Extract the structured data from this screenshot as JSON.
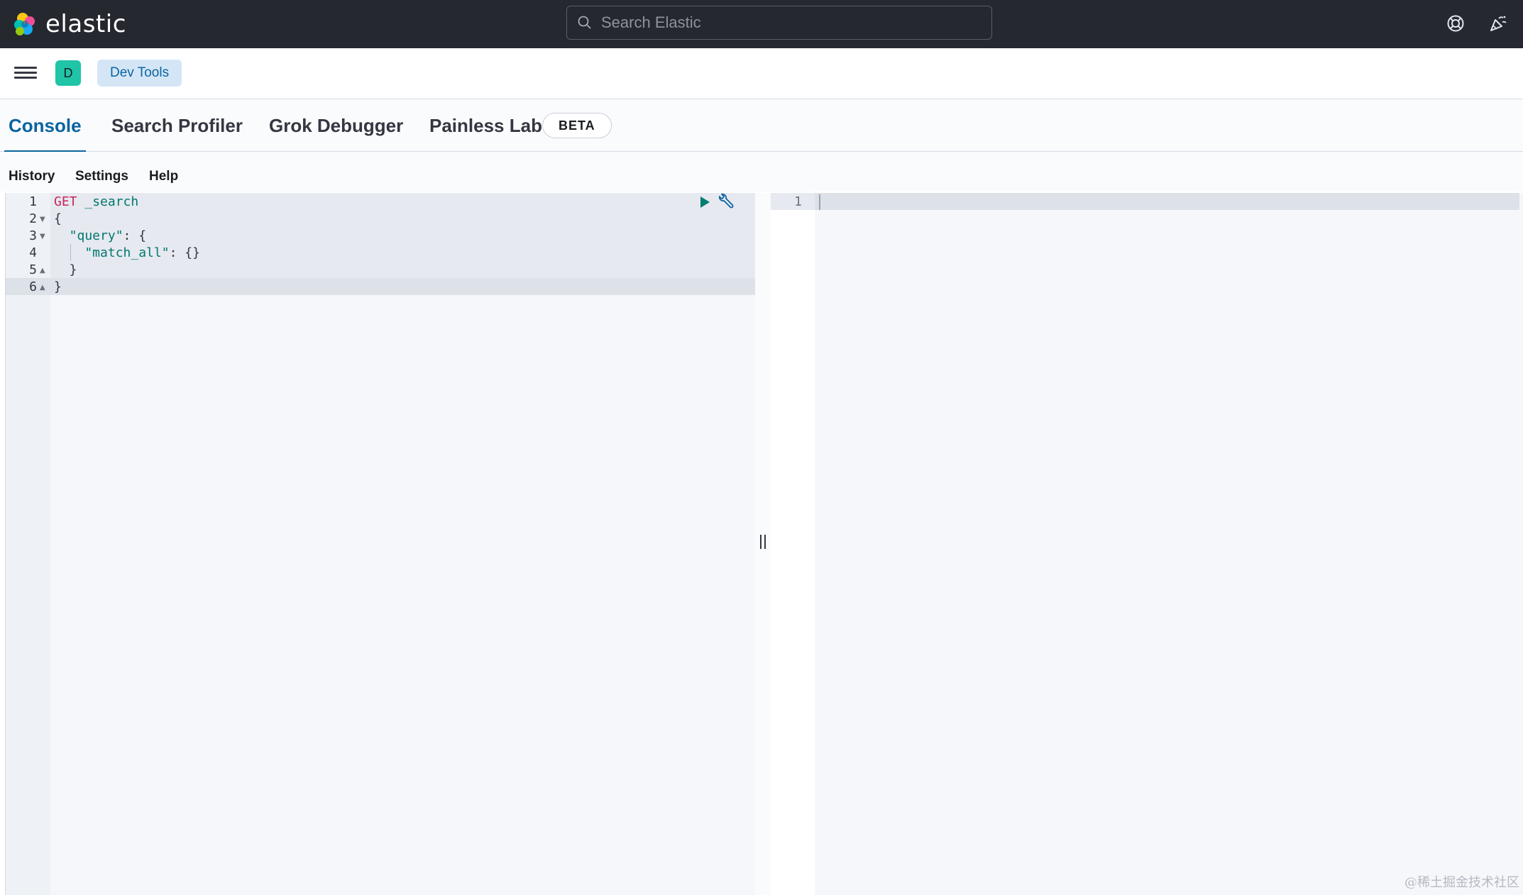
{
  "header": {
    "logo_text": "elastic",
    "search_placeholder": "Search Elastic",
    "icons": [
      "help-icon",
      "newsfeed-icon"
    ]
  },
  "subheader": {
    "space_initial": "D",
    "breadcrumb": "Dev Tools"
  },
  "tabs": [
    {
      "label": "Console",
      "active": true
    },
    {
      "label": "Search Profiler",
      "active": false
    },
    {
      "label": "Grok Debugger",
      "active": false
    },
    {
      "label": "Painless Lab",
      "active": false
    }
  ],
  "beta_badge": "BETA",
  "console_menu": [
    "History",
    "Settings",
    "Help"
  ],
  "editor": {
    "line_numbers": [
      "1",
      "2",
      "3",
      "4",
      "5",
      "6"
    ],
    "lines": {
      "l1_method": "GET",
      "l1_path": " _search",
      "l2": "{",
      "l3_key": "  \"query\"",
      "l3_rest": ": {",
      "l4_key": "    \"match_all\"",
      "l4_rest": ": {}",
      "l5": "  }",
      "l6": "}"
    }
  },
  "output": {
    "line_numbers": [
      "1"
    ]
  },
  "watermark": "@稀土掘金技术社区",
  "colors": {
    "header_bg": "#25282f",
    "accent": "#0b64a0",
    "keyword": "#c7275e",
    "string": "#007871",
    "space_avatar": "#20c4a7"
  }
}
